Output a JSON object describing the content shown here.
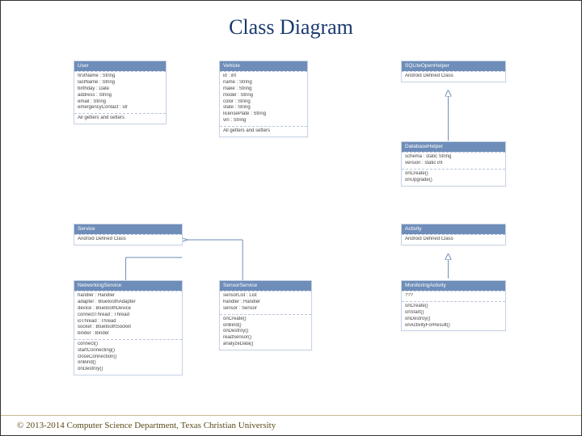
{
  "page": {
    "title": "Class Diagram",
    "footer": "© 2013-2014 Computer Science Department, Texas Christian University"
  },
  "classes": {
    "user": {
      "name": "User",
      "attrs": [
        "firstName : String",
        "lastName : String",
        "birthday : Date",
        "address : String",
        "email : String",
        "emergencyContact : str"
      ],
      "ops": [
        "All getters and setters"
      ]
    },
    "vehicle": {
      "name": "Vehicle",
      "attrs": [
        "id : int",
        "name : String",
        "make : String",
        "model : String",
        "color : String",
        "state : String",
        "licensePlate : String",
        "vin : String"
      ],
      "ops": [
        "All getters and setters"
      ]
    },
    "sqlite": {
      "name": "SQLiteOpenHelper",
      "attrs": [
        "Android Defined Class"
      ]
    },
    "dbhelper": {
      "name": "DatabaseHelper",
      "attrs": [
        "schema : static String",
        "version : static int"
      ],
      "ops": [
        "onCreate()",
        "onUpgrade()"
      ]
    },
    "service": {
      "name": "Service",
      "attrs": [
        "Android Defined Class"
      ]
    },
    "activity": {
      "name": "Activity",
      "attrs": [
        "Android Defined Class"
      ]
    },
    "netservice": {
      "name": "NetworkingService",
      "attrs": [
        "handler : Handler",
        "adapter : BluetoothAdapter",
        "device : BluetoothDevice",
        "connectThread : Thread",
        "ioThread : Thread",
        "socket : BluetoothSocket",
        "binder : Binder"
      ],
      "ops": [
        "connect()",
        "startConnecting()",
        "closeConnection()",
        "onBind()",
        "onDestroy()"
      ]
    },
    "sensorservice": {
      "name": "SensorService",
      "attrs": [
        "sensorList : List",
        "handler : Handler",
        "sensor : Sensor"
      ],
      "ops": [
        "onCreate()",
        "onBind()",
        "onDestroy()",
        "readSensor()",
        "analyzeData()"
      ]
    },
    "monitoring": {
      "name": "MonitoringActivity",
      "attrs": [
        "???"
      ],
      "ops": [
        "onCreate()",
        "onStart()",
        "onDestroy()",
        "onActivityForResult()"
      ]
    }
  }
}
